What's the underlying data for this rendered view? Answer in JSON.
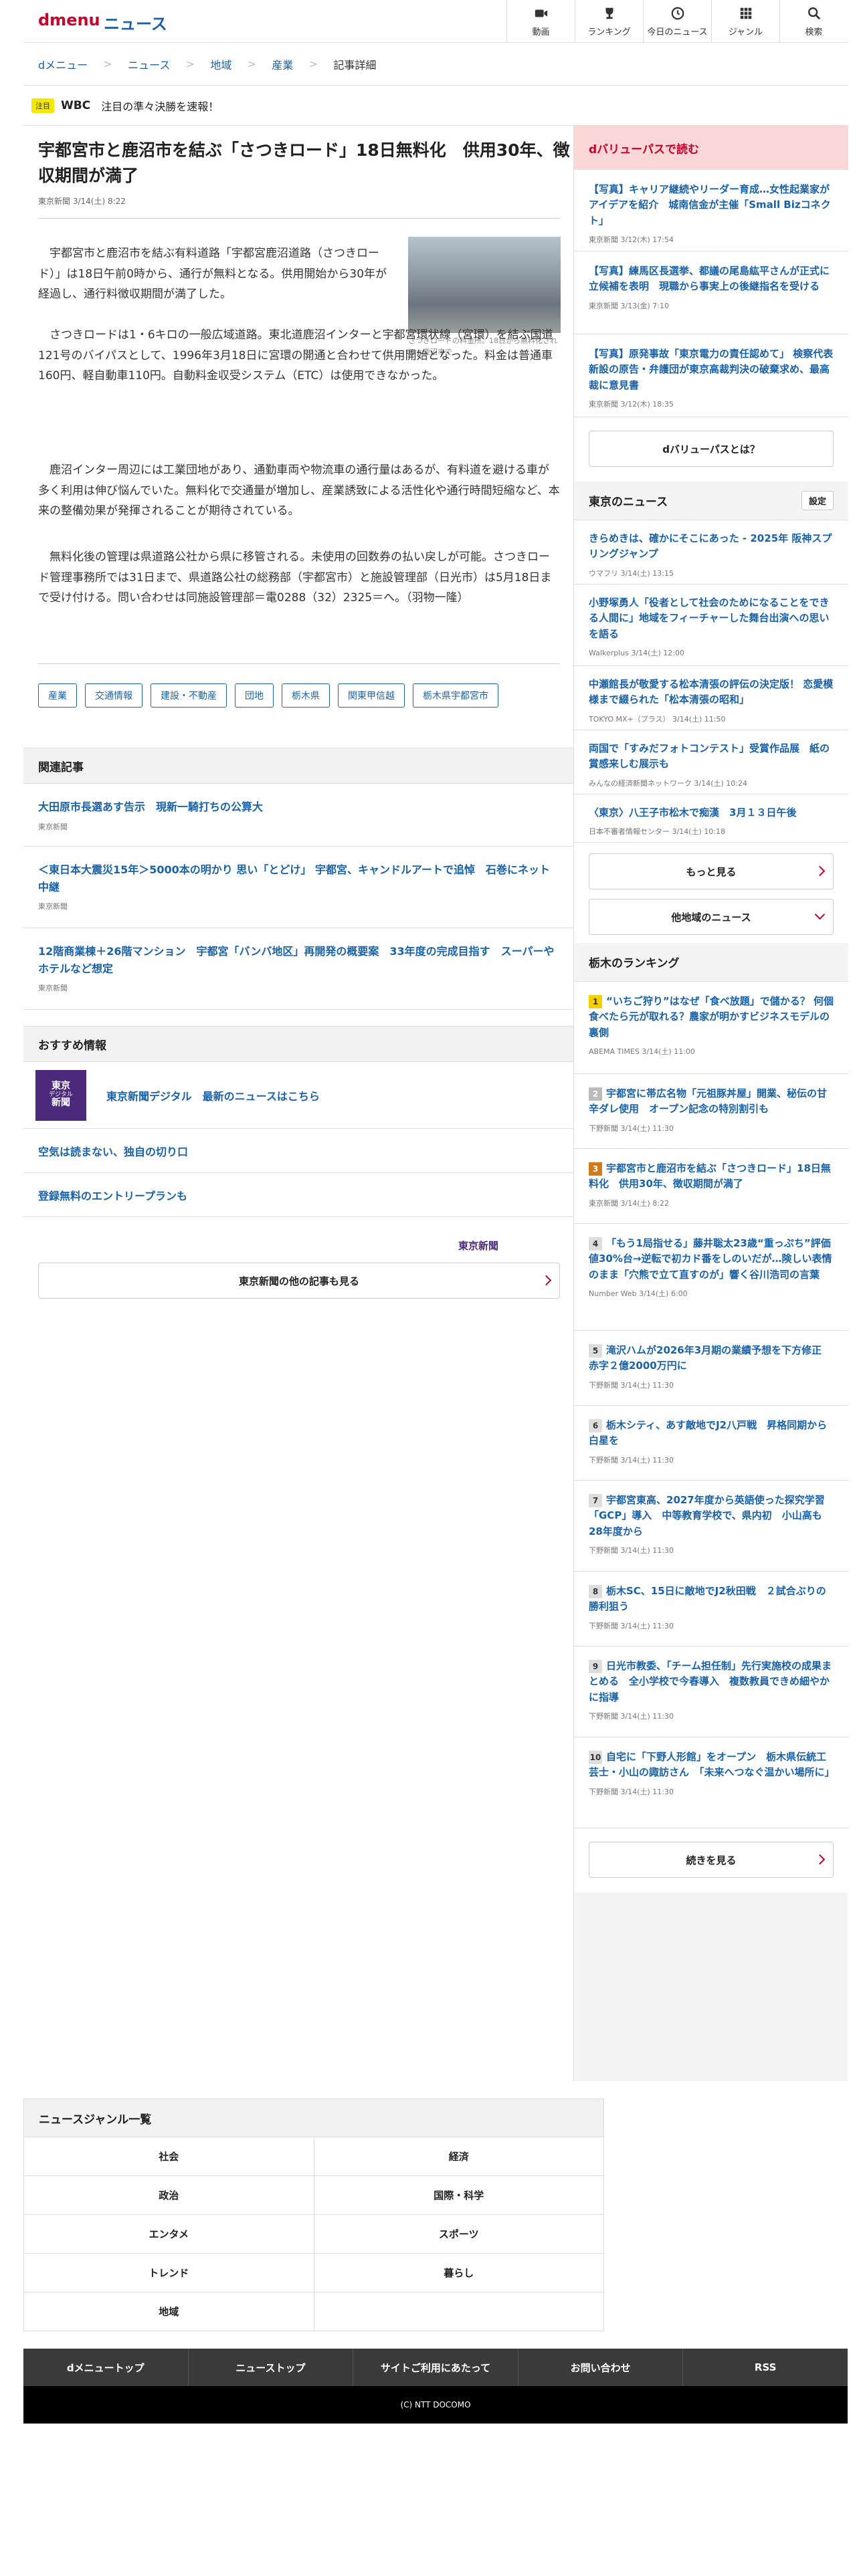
{
  "header": {
    "logo": "dmenu",
    "section": "ニュース",
    "nav": [
      {
        "label": "動画",
        "icon": "video-icon"
      },
      {
        "label": "ランキング",
        "icon": "trophy-icon"
      },
      {
        "label": "今日のニュース",
        "icon": "clock-icon"
      },
      {
        "label": "ジャンル",
        "icon": "grid-icon"
      },
      {
        "label": "検索",
        "icon": "search-icon"
      }
    ]
  },
  "breadcrumb": [
    "dメニュー",
    "ニュース",
    "地域",
    "産業",
    "記事詳細"
  ],
  "ticker": {
    "badge": "注目",
    "title": "WBC",
    "text": "注目の準々決勝を速報！"
  },
  "article": {
    "title": "宇都宮市と鹿沼市を結ぶ「さつきロード」18日無料化　供用30年、徴収期間が満了",
    "source": "東京新聞",
    "date": "3/14(土) 8:22",
    "photo_caption": "さつきロードの料金所。18日から無料化される＝鹿沼市で",
    "paragraphs": [
      "宇都宮市と鹿沼市を結ぶ有料道路「宇都宮鹿沼道路（さつきロード）」は18日午前0時から、通行が無料となる。供用開始から30年が経過し、通行料徴収期間が満了した。",
      "さつきロードは1・6キロの一般広域道路。東北道鹿沼インターと宇都宮環状線（宮環）を結ぶ国道121号のバイパスとして、1996年3月18日に宮環の開通と合わせて供用開始となった。料金は普通車160円、軽自動車110円。自動料金収受システム（ETC）は使用できなかった。",
      "鹿沼インター周辺には工業団地があり、通勤車両や物流車の通行量はあるが、有料道を避ける車が多く利用は伸び悩んでいた。無料化で交通量が増加し、産業誘致による活性化や通行時間短縮など、本来の整備効果が発揮されることが期待されている。",
      "無料化後の管理は県道路公社から県に移管される。未使用の回数券の払い戻しが可能。さつきロード管理事務所では31日まで、県道路公社の総務部（宇都宮市）と施設管理部（日光市）は5月18日まで受け付ける。問い合わせは同施設管理部＝電0288（32）2325＝へ。（羽物一隆）"
    ],
    "tags": [
      "産業",
      "交通情報",
      "建設・不動産",
      "団地",
      "栃木県",
      "関東甲信越",
      "栃木県宇都宮市"
    ]
  },
  "related": {
    "heading": "関連記事",
    "items": [
      {
        "title": "大田原市長選あす告示　現新一騎打ちの公算大",
        "source": "東京新聞"
      },
      {
        "title": "＜東日本大震災15年＞5000本の明かり 思い「とどけ」 宇都宮、キャンドルアートで追悼　石巻にネット中継",
        "source": "東京新聞"
      },
      {
        "title": "12階商業棟＋26階マンション　宇都宮「バンバ地区」再開発の概要案　33年度の完成目指す　スーパーやホテルなど想定",
        "source": "東京新聞"
      }
    ]
  },
  "recommend": {
    "heading": "おすすめ情報",
    "logo_lines": [
      "東京",
      "デジタル",
      "新聞"
    ],
    "items": [
      "東京新聞デジタル　最新のニュースはこちら",
      "空気は読まない、独自の切り口",
      "登録無料のエントリープランも"
    ],
    "brand_logo": "東京新聞",
    "more_label": "東京新聞の他の記事も見る"
  },
  "side": {
    "dvalue": {
      "heading": "dバリューパスで読む",
      "items": [
        {
          "title": "【写真】キャリア継続やリーダー育成…女性起業家がアイデアを紹介　城南信金が主催「Small Bizコネクト」",
          "meta": "東京新聞 3/12(木) 17:54"
        },
        {
          "title": "【写真】練馬区長選挙、都議の尾島紘平さんが正式に立候補を表明　現職から事実上の後継指名を受ける",
          "meta": "東京新聞 3/13(金) 7:10"
        },
        {
          "title": "【写真】原発事故「東京電力の責任認めて」 検察代表新設の原告・弁護団が東京高裁判決の破棄求め、最高裁に意見書",
          "meta": "東京新聞 3/12(木) 18:35"
        }
      ],
      "about_label": "dバリューパスとは？"
    },
    "local": {
      "heading": "東京のニュース",
      "setting_label": "設定",
      "items": [
        {
          "title": "きらめきは、確かにそこにあった - 2025年 阪神スプリングジャンプ",
          "meta": "ウマフリ 3/14(土) 13:15"
        },
        {
          "title": "小野塚勇人「役者として社会のためになることをできる人間に」地域をフィーチャーした舞台出演への思いを語る",
          "meta": "Walkerplus 3/14(土) 12:00"
        },
        {
          "title": "中瀬館長が敬愛する松本清張の評伝の決定版！ 恋愛模様まで綴られた「松本清張の昭和」",
          "meta": "TOKYO MX+（プラス） 3/14(土) 11:50"
        },
        {
          "title": "両国で「すみだフォトコンテスト」受賞作品展　紙の賞感来しむ展示も",
          "meta": "みんなの経済新聞ネットワーク 3/14(土) 10:24"
        },
        {
          "title": "〈東京〉八王子市松木で痴漢　3月１３日午後",
          "meta": "日本不審者情報センター 3/14(土) 10:18"
        }
      ],
      "more_label": "もっと見る",
      "other_label": "他地域のニュース"
    },
    "ranking": {
      "heading": "栃木のランキング",
      "items": [
        {
          "rank": "1",
          "title": "“いちご狩り”はなぜ「食べ放題」で儲かる？ 何個食べたら元が取れる？農家が明かすビジネスモデルの裏側",
          "meta": "ABEMA TIMES 3/14(土) 11:00"
        },
        {
          "rank": "2",
          "title": "宇都宮に帯広名物「元祖豚丼屋」開業、秘伝の甘辛ダレ使用　オープン記念の特別割引も",
          "meta": "下野新聞 3/14(土) 11:30"
        },
        {
          "rank": "3",
          "title": "宇都宮市と鹿沼市を結ぶ「さつきロード」18日無料化　供用30年、徴収期間が満了",
          "meta": "東京新聞 3/14(土) 8:22"
        },
        {
          "rank": "4",
          "title": "「もう1局指せる」藤井聡太23歳“重っぷち”評価値30%台→逆転で初カド番をしのいだが…険しい表情のまま「穴熊で立て直すのが」響く谷川浩司の言葉",
          "meta": "Number Web 3/14(土) 6:00"
        },
        {
          "rank": "5",
          "title": "滝沢ハムが2026年3月期の業績予想を下方修正　赤字２億2000万円に",
          "meta": "下野新聞 3/14(土) 11:30"
        },
        {
          "rank": "6",
          "title": "栃木シティ、あす敵地でJ2八戸戦　昇格同期から白星を",
          "meta": "下野新聞 3/14(土) 11:30"
        },
        {
          "rank": "7",
          "title": "宇都宮東高、2027年度から英語使った探究学習「GCP」導入　中等教育学校で、県内初　小山高も28年度から",
          "meta": "下野新聞 3/14(土) 11:30"
        },
        {
          "rank": "8",
          "title": "栃木SC、15日に敵地でJ2秋田戦　２試合ぶりの勝利狙う",
          "meta": "下野新聞 3/14(土) 11:30"
        },
        {
          "rank": "9",
          "title": "日光市教委、「チーム担任制」先行実施校の成果まとめる　全小学校で今春導入　複数教員できめ細やかに指導",
          "meta": "下野新聞 3/14(土) 11:30"
        },
        {
          "rank": "10",
          "title": "自宅に「下野人形館」をオープン　栃木県伝統工芸士・小山の諏訪さん　「未来へつなぐ温かい場所に」",
          "meta": "下野新聞 3/14(土) 11:30"
        }
      ],
      "more_label": "続きを見る"
    }
  },
  "genres": {
    "heading": "ニュースジャンル一覧",
    "items": [
      "社会",
      "経済",
      "政治",
      "国際・科学",
      "エンタメ",
      "スポーツ",
      "トレンド",
      "暮らし",
      "地域",
      ""
    ]
  },
  "footer": {
    "nav": [
      "dメニュートップ",
      "ニューストップ",
      "サイトご利用にあたって",
      "お問い合わせ",
      "RSS"
    ],
    "copyright": "(C) NTT DOCOMO"
  },
  "colors": {
    "brand": "#c4002b",
    "link": "#1a62a8",
    "side_bg": "#f4f4f4",
    "dvalue_head_bg": "#f9d7d7"
  }
}
